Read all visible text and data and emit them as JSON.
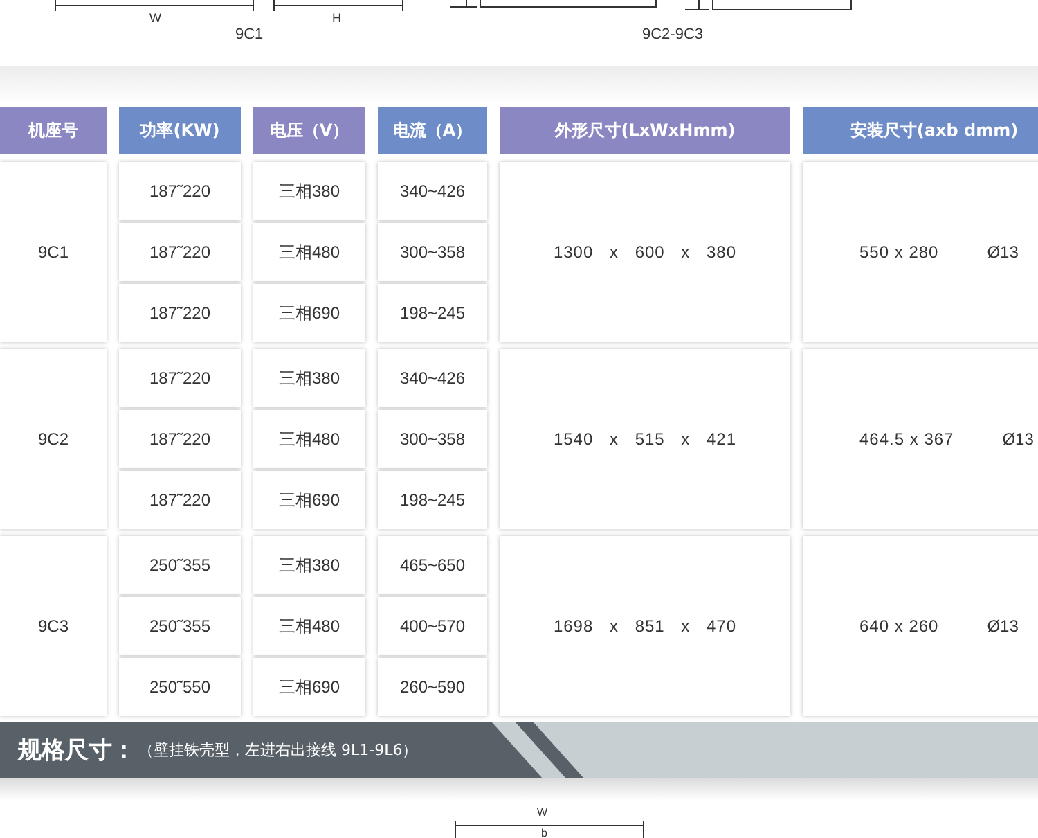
{
  "top_drawing": {
    "labels": [
      "W",
      "H"
    ],
    "captions": [
      "9C1",
      "9C2-9C3"
    ]
  },
  "table": {
    "columns": [
      {
        "label": "机座号",
        "color": "#8b87c2"
      },
      {
        "label": "功率(KW)",
        "color": "#6e8cc8"
      },
      {
        "label": "电压（V）",
        "color": "#8b87c2"
      },
      {
        "label": "电流（A）",
        "color": "#6e8cc8"
      },
      {
        "label": "外形尺寸(LxWxHmm)",
        "color": "#8b87c2"
      },
      {
        "label": "安装尺寸(axb dmm)",
        "color": "#6e8cc8"
      }
    ],
    "groups": [
      {
        "frame": "9C1",
        "dimensions": "1300 x 600 x 380",
        "mounting": "550 x 280",
        "hole": "Ø13",
        "rows": [
          {
            "power": "187˜220",
            "voltage": "三相380",
            "current": "340~426"
          },
          {
            "power": "187˜220",
            "voltage": "三相480",
            "current": "300~358"
          },
          {
            "power": "187˜220",
            "voltage": "三相690",
            "current": "198~245"
          }
        ]
      },
      {
        "frame": "9C2",
        "dimensions": "1540 x 515 x 421",
        "mounting": "464.5 x 367",
        "hole": "Ø13",
        "rows": [
          {
            "power": "187˜220",
            "voltage": "三相380",
            "current": "340~426"
          },
          {
            "power": "187˜220",
            "voltage": "三相480",
            "current": "300~358"
          },
          {
            "power": "187˜220",
            "voltage": "三相690",
            "current": "198~245"
          }
        ]
      },
      {
        "frame": "9C3",
        "dimensions": "1698 x 851 x 470",
        "mounting": "640 x 260",
        "hole": "Ø13",
        "rows": [
          {
            "power": "250˜355",
            "voltage": "三相380",
            "current": "465~650"
          },
          {
            "power": "250˜355",
            "voltage": "三相480",
            "current": "400~570"
          },
          {
            "power": "250˜550",
            "voltage": "三相690",
            "current": "260~590"
          }
        ]
      }
    ]
  },
  "section_banner": {
    "title": "规格尺寸：",
    "subtitle": "（壁挂铁壳型，左进右出接线 9L1-9L6）"
  },
  "bottom_drawing": {
    "labels": [
      "W",
      "b"
    ]
  }
}
